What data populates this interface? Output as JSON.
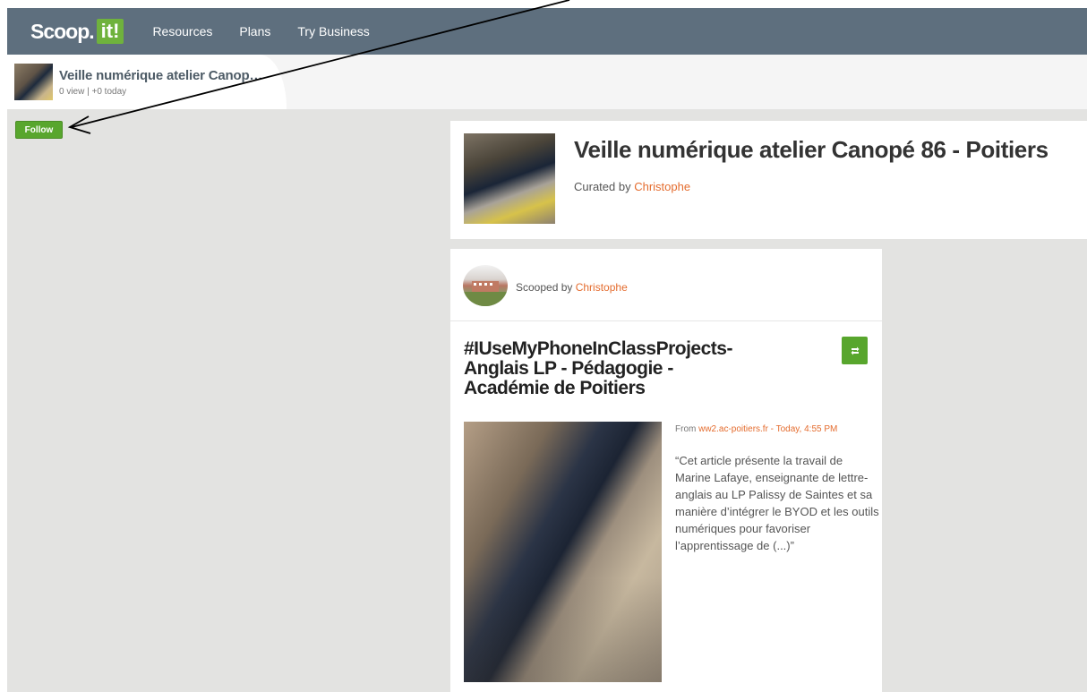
{
  "nav": {
    "logo_text": "Scoop.",
    "logo_badge": "it!",
    "links": [
      "Resources",
      "Plans",
      "Try Business"
    ]
  },
  "subheader": {
    "title": "Veille numérique atelier Canop…",
    "stats": "0 view | +0 today"
  },
  "follow_label": "Follow",
  "topic": {
    "title": "Veille numérique atelier Canopé 86 - Poitiers",
    "curated_prefix": "Curated by ",
    "curator": "Christophe"
  },
  "post": {
    "scooped_prefix": "Scooped by ",
    "scooper": "Christophe",
    "title_lines": [
      "#IUseMyPhoneInClassProjects-",
      "Anglais LP - Pédagogie -",
      "Académie de Poitiers"
    ],
    "source_prefix": "From ",
    "source": "ww2.ac-poitiers.fr - Today, 4:55 PM",
    "excerpt": "“Cet article présente la travail de Marine Lafaye, enseignante de lettre-anglais au LP Palissy de Saintes et sa manière d’intégrer le BYOD et les outils numériques pour favoriser l’apprentissage de (...)”"
  },
  "colors": {
    "topbar": "#5e6f7e",
    "brand_green": "#6fb23d",
    "button_green": "#58a62d",
    "link_orange": "#e46c2e",
    "content_gray": "#e3e3e1"
  },
  "icons": {
    "rescoop": "rescoop-icon",
    "annotation": "arrow-pointer-icon"
  }
}
